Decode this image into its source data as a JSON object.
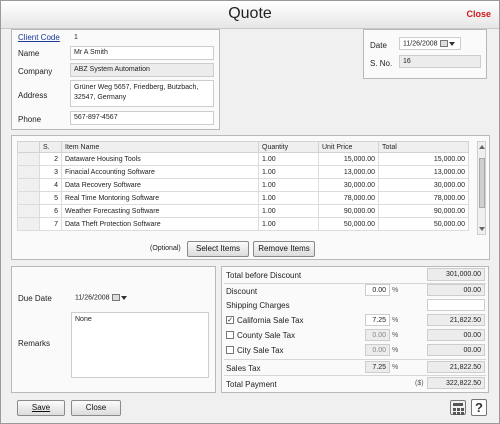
{
  "window": {
    "title": "Quote",
    "close_label": "Close"
  },
  "client": {
    "code_label": "Client Code",
    "code_value": "1",
    "name_label": "Name",
    "name_value": "Mr A Smith",
    "company_label": "Company",
    "company_value": "ABZ System Automation",
    "address_label": "Address",
    "address_value": "Grüner Weg 5657, Friedberg, Butzbach, 32547, Germany",
    "phone_label": "Phone",
    "phone_value": "567-897-4567"
  },
  "doc": {
    "date_label": "Date",
    "date_value": "11/26/2008",
    "sno_label": "S. No.",
    "sno_value": "16"
  },
  "items_table": {
    "headers": [
      "S.",
      "Item Name",
      "Quantity",
      "Unit Price",
      "Total"
    ],
    "rows": [
      [
        "2",
        "Dataware Housing Tools",
        "1.00",
        "15,000.00",
        "15,000.00"
      ],
      [
        "3",
        "Finacial Accounting Software",
        "1.00",
        "13,000.00",
        "13,000.00"
      ],
      [
        "4",
        "Data Recovery Software",
        "1.00",
        "30,000.00",
        "30,000.00"
      ],
      [
        "5",
        "Real Time Montoring Software",
        "1.00",
        "78,000.00",
        "78,000.00"
      ],
      [
        "6",
        "Weather Forecasting Software",
        "1.00",
        "90,000.00",
        "90,000.00"
      ],
      [
        "7",
        "Data Theft Protection Software",
        "1.00",
        "50,000.00",
        "50,000.00"
      ]
    ]
  },
  "item_actions": {
    "optional_label": "(Optional)",
    "select_label": "Select Items",
    "remove_label": "Remove Items"
  },
  "meta": {
    "due_date_label": "Due Date",
    "due_date_value": "11/26/2008",
    "remarks_label": "Remarks",
    "remarks_value": "None"
  },
  "totals": {
    "before_discount_label": "Total before Discount",
    "before_discount_value": "301,000.00",
    "discount_label": "Discount",
    "discount_pct": "0.00",
    "discount_value": "00.00",
    "shipping_label": "Shipping Charges",
    "shipping_value": "",
    "ca_tax_label": "California Sale Tax",
    "ca_tax_pct": "7.25",
    "ca_tax_value": "21,822.50",
    "county_tax_label": "County Sale Tax",
    "county_tax_pct": "0.00",
    "county_tax_value": "00.00",
    "city_tax_label": "City Sale Tax",
    "city_tax_pct": "0.00",
    "city_tax_value": "00.00",
    "sales_tax_label": "Sales Tax",
    "sales_tax_pct": "7.25",
    "sales_tax_value": "21,822.50",
    "total_payment_label": "Total Payment",
    "currency": "($)",
    "total_payment_value": "322,822.50",
    "percent_sign": "%"
  },
  "footer": {
    "save_label": "Save",
    "close_label": "Close"
  },
  "colors": {
    "close_red": "#d01818",
    "link_blue": "#1a3a9a"
  },
  "icons": {
    "calculator": "calculator-icon",
    "help": "help-icon",
    "calendar": "calendar-icon"
  }
}
